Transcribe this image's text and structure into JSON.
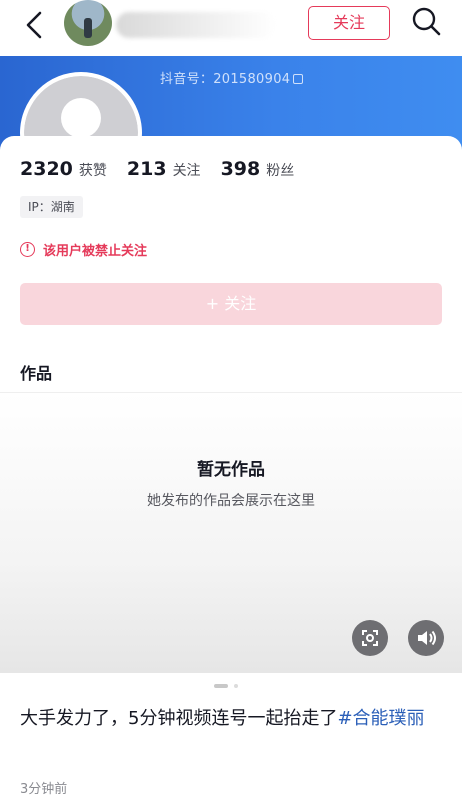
{
  "topbar": {
    "follow_label": "关注",
    "back_icon": "back-arrow-icon",
    "search_icon": "search-icon"
  },
  "profile": {
    "douyin_id": "抖音号：201580904",
    "likes_count": "2320",
    "likes_label": "获赞",
    "following_count": "213",
    "following_label": "关注",
    "followers_count": "398",
    "followers_label": "粉丝",
    "ip_location": "IP：湖南",
    "ban_notice": "该用户被禁止关注",
    "follow_button_label": "+ 关注"
  },
  "works": {
    "title": "作品",
    "empty_title": "暂无作品",
    "empty_subtitle": "她发布的作品会展示在这里"
  },
  "post": {
    "caption_text": "大手发力了，5分钟视频连号一起抬走了",
    "hashtag": "#合能璞丽",
    "time": "3分钟前"
  },
  "colors": {
    "accent": "#e53a5a",
    "banner": "#3a82ea",
    "hashtag": "#2b5fb8"
  }
}
